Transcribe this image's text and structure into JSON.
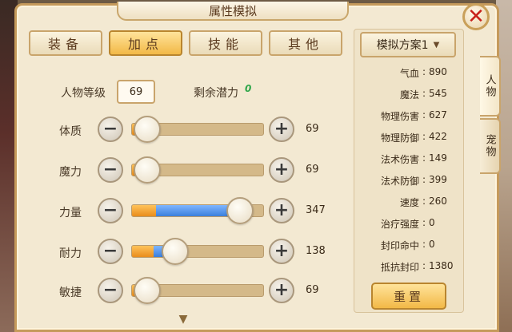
{
  "window": {
    "title": "属性模拟"
  },
  "tabs": [
    {
      "label": "装备",
      "active": false
    },
    {
      "label": "加点",
      "active": true
    },
    {
      "label": "技能",
      "active": false
    },
    {
      "label": "其他",
      "active": false
    }
  ],
  "level": {
    "label": "人物等级",
    "value": "69"
  },
  "potential": {
    "label": "剩余潜力",
    "value": "0"
  },
  "attributes": [
    {
      "label": "体质",
      "value": "69",
      "orange_fraction": 0.12,
      "blue_fraction": 0.0,
      "knob_fraction": 0.12
    },
    {
      "label": "魔力",
      "value": "69",
      "orange_fraction": 0.12,
      "blue_fraction": 0.0,
      "knob_fraction": 0.12
    },
    {
      "label": "力量",
      "value": "347",
      "orange_fraction": 0.18,
      "blue_fraction": 0.62,
      "knob_fraction": 0.82
    },
    {
      "label": "耐力",
      "value": "138",
      "orange_fraction": 0.16,
      "blue_fraction": 0.08,
      "knob_fraction": 0.33
    },
    {
      "label": "敏捷",
      "value": "69",
      "orange_fraction": 0.12,
      "blue_fraction": 0.0,
      "knob_fraction": 0.12
    }
  ],
  "minus_glyph": "−",
  "plus_glyph": "+",
  "scheme": {
    "label": "模拟方案1"
  },
  "stats": [
    {
      "name": "气血",
      "value": "890"
    },
    {
      "name": "魔法",
      "value": "545"
    },
    {
      "name": "物理伤害",
      "value": "627"
    },
    {
      "name": "物理防御",
      "value": "422"
    },
    {
      "name": "法术伤害",
      "value": "149"
    },
    {
      "name": "法术防御",
      "value": "399"
    },
    {
      "name": "速度",
      "value": "260"
    },
    {
      "name": "治疗强度",
      "value": "0"
    },
    {
      "name": "封印命中",
      "value": "0"
    },
    {
      "name": "抵抗封印",
      "value": "1380"
    }
  ],
  "stat_separator": ":",
  "reset": {
    "label": "重置"
  },
  "side_tabs": [
    {
      "label": "人物",
      "active": true
    },
    {
      "label": "宠物",
      "active": false
    }
  ],
  "icons": {
    "close": "close-icon",
    "chevron": "chevron-down-icon",
    "scroll": "scroll-down-icon"
  },
  "colors": {
    "panel_bg": "#f3e9d2",
    "accent_gold": "#f2b947",
    "bar_orange": "#e98d1c",
    "bar_blue": "#3a7fdc",
    "close_red": "#c8201a",
    "potential_green": "#2fa64a"
  }
}
